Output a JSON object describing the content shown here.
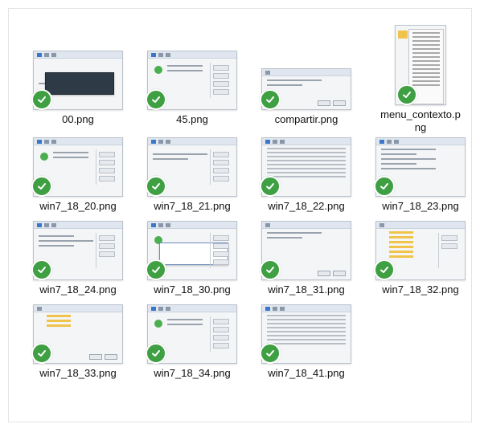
{
  "files": [
    {
      "name": "00.png",
      "thumb": "dialog-dark"
    },
    {
      "name": "45.png",
      "thumb": "installer"
    },
    {
      "name": "compartir.png",
      "thumb": "dialog-share"
    },
    {
      "name": "menu_contexto.png",
      "thumb": "context-menu",
      "label_lines": [
        "menu_contexto.p",
        "ng"
      ]
    },
    {
      "name": "win7_18_20.png",
      "thumb": "installer"
    },
    {
      "name": "win7_18_21.png",
      "thumb": "installer"
    },
    {
      "name": "win7_18_22.png",
      "thumb": "table"
    },
    {
      "name": "win7_18_23.png",
      "thumb": "text"
    },
    {
      "name": "win7_18_24.png",
      "thumb": "form"
    },
    {
      "name": "win7_18_30.png",
      "thumb": "installer-dialog"
    },
    {
      "name": "win7_18_31.png",
      "thumb": "dialog-small"
    },
    {
      "name": "win7_18_32.png",
      "thumb": "tree"
    },
    {
      "name": "win7_18_33.png",
      "thumb": "tree"
    },
    {
      "name": "win7_18_34.png",
      "thumb": "installer"
    },
    {
      "name": "win7_18_41.png",
      "thumb": "table"
    }
  ],
  "status_icon": "sync-check-icon",
  "colors": {
    "check_green": "#3f9f43",
    "thumb_accent": "#3a77c9"
  }
}
